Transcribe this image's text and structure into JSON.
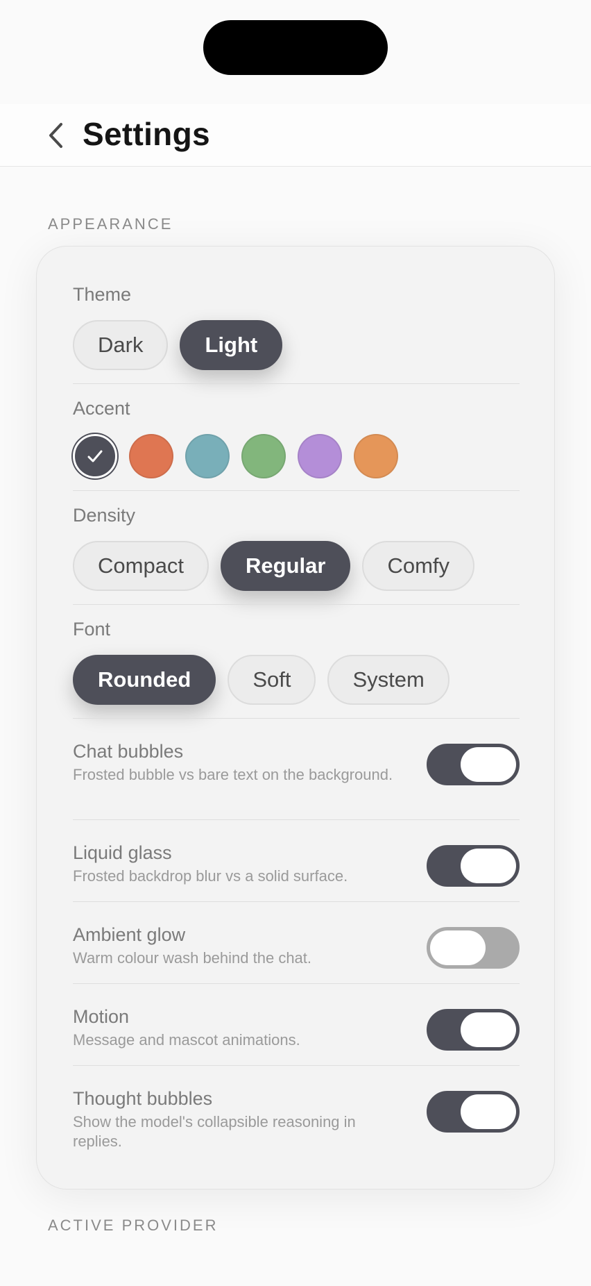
{
  "header": {
    "title": "Settings"
  },
  "sections": {
    "appearance": "APPEARANCE",
    "active_provider": "ACTIVE PROVIDER"
  },
  "theme": {
    "label": "Theme",
    "options": [
      "Dark",
      "Light"
    ],
    "selected": "Light"
  },
  "accent": {
    "label": "Accent",
    "colors": [
      "#4e4f59",
      "#df7652",
      "#79afb9",
      "#82b67c",
      "#b48ed8",
      "#e59659"
    ],
    "selected_index": 0
  },
  "density": {
    "label": "Density",
    "options": [
      "Compact",
      "Regular",
      "Comfy"
    ],
    "selected": "Regular"
  },
  "font": {
    "label": "Font",
    "options": [
      "Rounded",
      "Soft",
      "System"
    ],
    "selected": "Rounded"
  },
  "toggles": [
    {
      "title": "Chat bubbles",
      "desc": "Frosted bubble vs bare text on the background.",
      "on": true
    },
    {
      "title": "Liquid glass",
      "desc": "Frosted backdrop blur vs a solid surface.",
      "on": true
    },
    {
      "title": "Ambient glow",
      "desc": "Warm colour wash behind the chat.",
      "on": false
    },
    {
      "title": "Motion",
      "desc": "Message and mascot animations.",
      "on": true
    },
    {
      "title": "Thought bubbles",
      "desc": "Show the model's collapsible reasoning in replies.",
      "on": true
    }
  ]
}
